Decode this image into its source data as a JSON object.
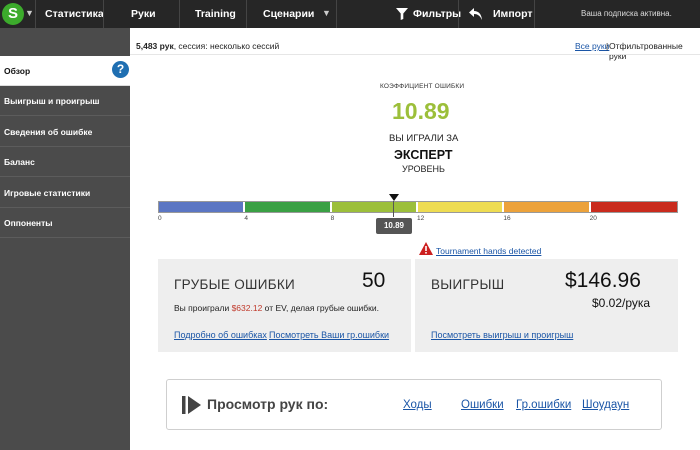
{
  "topbar": {
    "logo_letter": "S",
    "nav": {
      "stats": "Статистика",
      "hands": "Руки",
      "training": "Training",
      "scenarios": "Сценарии",
      "filters": "Фильтры",
      "import": "Импорт"
    },
    "subscription": "Ваша подписка активна."
  },
  "sidebar": {
    "items": [
      "Обзор",
      "Выигрыш и проигрыш",
      "Сведения об ошибке",
      "Баланс",
      "Игровые статистики",
      "Оппоненты"
    ],
    "help_glyph": "?"
  },
  "stats_line": {
    "count": "5,483 рук",
    "rest": ", сессия: несколько сессий"
  },
  "hand_filter": {
    "all": "Все руки",
    "separator": " | ",
    "filtered": "Отфильтрованные руки"
  },
  "error_rate": {
    "label": "КОЭФФИЦИЕНТ ОШИБКИ",
    "value": "10.89",
    "played_label": "ВЫ ИГРАЛИ ЗА",
    "level": "ЭКСПЕРТ",
    "level_suffix": "УРОВЕНЬ",
    "scale_ticks": [
      "0",
      "4",
      "8",
      "12",
      "16",
      "20"
    ],
    "scale_max": 24,
    "marker_value": 10.89,
    "marker_label": "10.89"
  },
  "scale_colors": [
    "#5b76c3",
    "#3aa044",
    "#9cbf3a",
    "#eedc52",
    "#eca23b",
    "#c92b1d"
  ],
  "tournament_warning": "Tournament hands detected",
  "blunders": {
    "title": "ГРУБЫЕ ОШИБКИ",
    "count": "50",
    "line_pre": "Вы проиграли ",
    "line_amount": "$632.12",
    "line_post": " от EV, делая грубые ошибки.",
    "link_details": "Подробно об ошибках",
    "link_view": "Посмотреть Ваши гр.ошибки"
  },
  "winnings": {
    "title": "ВЫИГРЫШ",
    "amount": "$146.96",
    "per_hand": "$0.02/рука",
    "link": "Посмотреть выигрыш и проигрыш"
  },
  "browse": {
    "title": "Просмотр рук по:",
    "links": [
      "Ходы",
      "Ошибки",
      "Гр.ошибки",
      "Шоудаун"
    ]
  }
}
